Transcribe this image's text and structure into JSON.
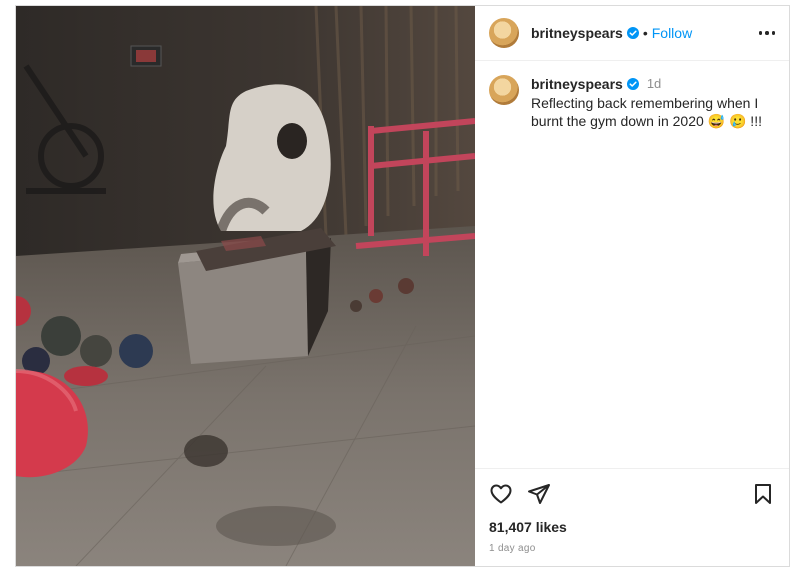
{
  "post": {
    "username": "britneyspears",
    "follow_label": "Follow",
    "separator": "•",
    "caption": {
      "username": "britneyspears",
      "time": "1d",
      "text": "Reflecting back remembering when I burnt the gym down in 2020 😅 🥲 !!!"
    },
    "likes": "81,407 likes",
    "time_ago": "1 day ago"
  },
  "icons": {
    "verified": "verified-badge-icon",
    "more": "more-options-icon",
    "like": "heart-icon",
    "share": "share-icon",
    "save": "bookmark-icon"
  },
  "colors": {
    "accent": "#0095f6",
    "verified": "#0095f6",
    "text": "#262626",
    "muted": "#8e8e8e"
  }
}
